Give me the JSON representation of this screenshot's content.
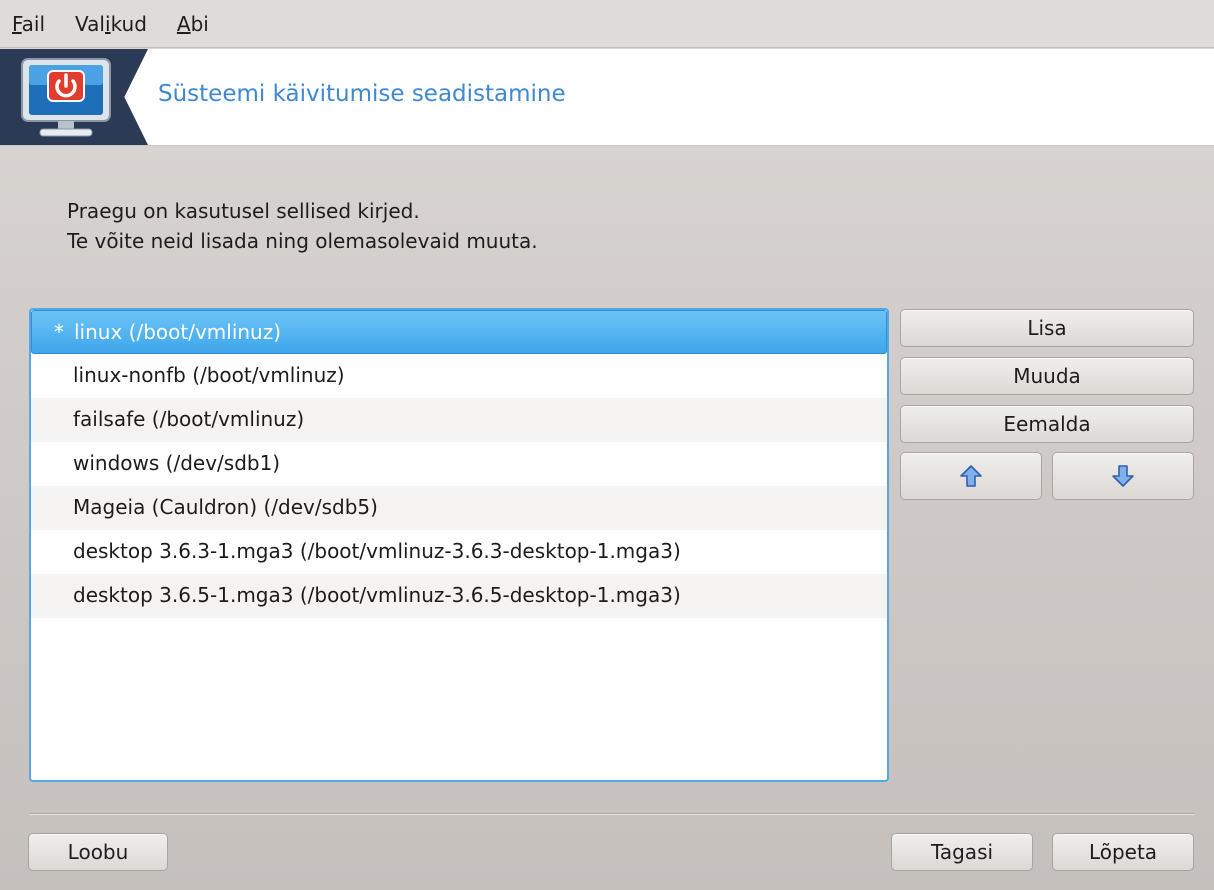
{
  "menubar": {
    "items": [
      {
        "mnemonic": "F",
        "rest": "ail"
      },
      {
        "pre": "Val",
        "mnemonic": "i",
        "rest": "kud"
      },
      {
        "mnemonic": "A",
        "rest": "bi"
      }
    ]
  },
  "banner": {
    "title": "Süsteemi käivitumise seadistamine",
    "icon": "computer-power-icon"
  },
  "info": {
    "line1": "Praegu on kasutusel sellised kirjed.",
    "line2": "Te võite neid lisada ning olemasolevaid muuta."
  },
  "entries": {
    "default_marker": "*",
    "items": [
      {
        "label": "linux (/boot/vmlinuz)",
        "selected": true,
        "default": true
      },
      {
        "label": "linux-nonfb (/boot/vmlinuz)"
      },
      {
        "label": "failsafe (/boot/vmlinuz)"
      },
      {
        "label": "windows (/dev/sdb1)"
      },
      {
        "label": "Mageia (Cauldron) (/dev/sdb5)"
      },
      {
        "label": "desktop 3.6.3-1.mga3 (/boot/vmlinuz-3.6.3-desktop-1.mga3)"
      },
      {
        "label": "desktop 3.6.5-1.mga3 (/boot/vmlinuz-3.6.5-desktop-1.mga3)"
      }
    ]
  },
  "buttons": {
    "add": "Lisa",
    "modify": "Muuda",
    "remove": "Eemalda",
    "move_up_icon": "arrow-up-icon",
    "move_down_icon": "arrow-down-icon",
    "cancel": "Loobu",
    "back": "Tagasi",
    "finish": "Lõpeta"
  },
  "colors": {
    "selection": "#3ea6ea",
    "title": "#3f88d0",
    "arrow": "#3d73c8"
  }
}
